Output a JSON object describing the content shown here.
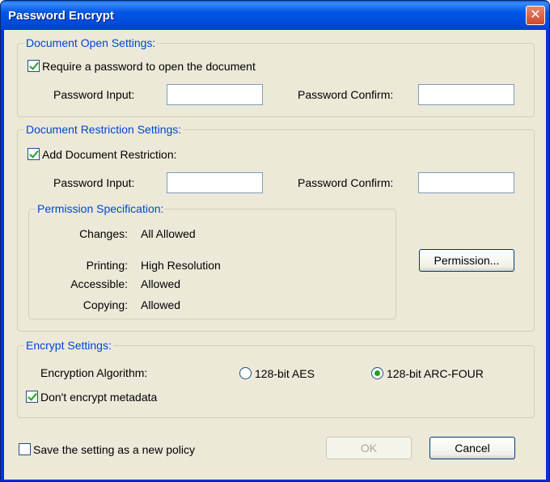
{
  "window": {
    "title": "Password Encrypt",
    "close_glyph": "✕"
  },
  "open_settings": {
    "legend": "Document Open Settings:",
    "require_label": "Require a password to open the document",
    "require_checked": true,
    "password_input_label": "Password Input:",
    "password_confirm_label": "Password Confirm:",
    "password_input_value": "",
    "password_confirm_value": ""
  },
  "restriction_settings": {
    "legend": "Document Restriction Settings:",
    "add_label": "Add Document Restriction:",
    "add_checked": true,
    "password_input_label": "Password Input:",
    "password_confirm_label": "Password Confirm:",
    "password_input_value": "",
    "password_confirm_value": "",
    "permission_spec": {
      "legend": "Permission Specification:",
      "rows": [
        {
          "label": "Changes:",
          "value": "All Allowed"
        },
        {
          "label": "Printing:",
          "value": "High Resolution"
        },
        {
          "label": "Accessible:",
          "value": "Allowed"
        },
        {
          "label": "Copying:",
          "value": "Allowed"
        }
      ]
    },
    "permission_button": "Permission..."
  },
  "encrypt_settings": {
    "legend": "Encrypt Settings:",
    "algorithm_label": "Encryption Algorithm:",
    "options": [
      {
        "label": "128-bit AES",
        "selected": false
      },
      {
        "label": "128-bit ARC-FOUR",
        "selected": true
      }
    ],
    "metadata_label": "Don't encrypt metadata",
    "metadata_checked": true
  },
  "footer": {
    "save_policy_label": "Save the setting as a new policy",
    "save_policy_checked": false,
    "ok_label": "OK",
    "ok_enabled": false,
    "cancel_label": "Cancel"
  }
}
